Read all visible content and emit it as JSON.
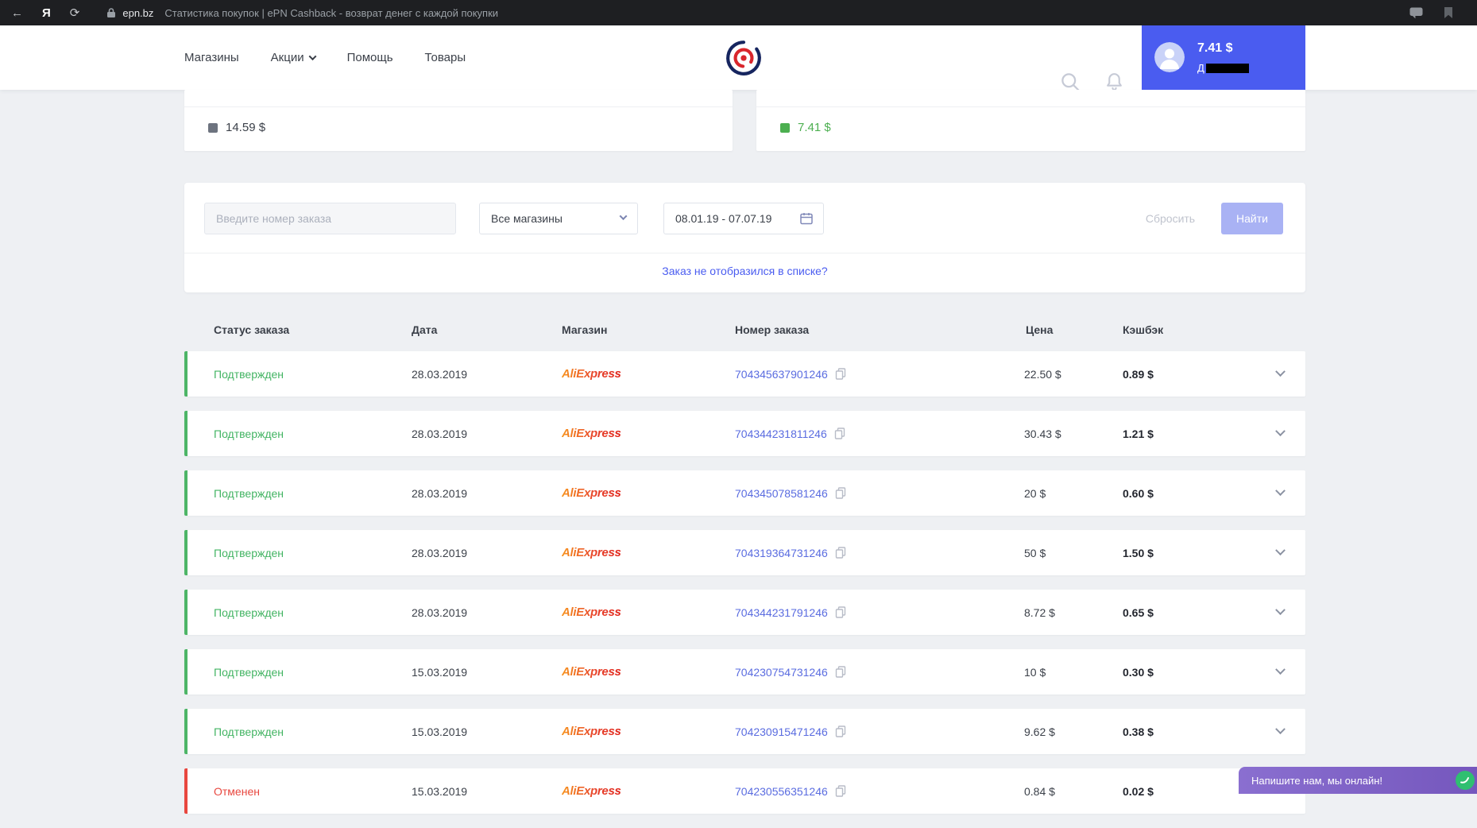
{
  "browser": {
    "back_icon": "←",
    "logo_letter": "Я",
    "refresh_icon": "⟳",
    "domain": "epn.bz",
    "page_title": "Статистика покупок | ePN Cashback - возврат денег с каждой покупки"
  },
  "header": {
    "nav": [
      {
        "label": "Магазины"
      },
      {
        "label": "Акции"
      },
      {
        "label": "Помощь"
      },
      {
        "label": "Товары"
      }
    ],
    "balance": "7.41 $",
    "user_name_prefix": "Д"
  },
  "stats": {
    "total": {
      "value": "14.59 $",
      "color": "#6d737f"
    },
    "available": {
      "value": "7.41 $",
      "color": "#4caf50"
    }
  },
  "filter": {
    "order_placeholder": "Введите номер заказа",
    "shop_select_value": "Все магазины",
    "date_range": "08.01.19 - 07.07.19",
    "reset_label": "Сбросить",
    "find_label": "Найти",
    "missing_order_link": "Заказ не отобразился в списке?"
  },
  "table": {
    "headers": [
      "Статус заказа",
      "Дата",
      "Магазин",
      "Номер заказа",
      "Цена",
      "Кэшбэк"
    ],
    "rows": [
      {
        "status": "Подтвержден",
        "status_type": "confirmed",
        "date": "28.03.2019",
        "shop": "AliExpress",
        "order": "704345637901246",
        "price": "22.50 $",
        "cashback": "0.89 $"
      },
      {
        "status": "Подтвержден",
        "status_type": "confirmed",
        "date": "28.03.2019",
        "shop": "AliExpress",
        "order": "704344231811246",
        "price": "30.43 $",
        "cashback": "1.21 $"
      },
      {
        "status": "Подтвержден",
        "status_type": "confirmed",
        "date": "28.03.2019",
        "shop": "AliExpress",
        "order": "704345078581246",
        "price": "20 $",
        "cashback": "0.60 $"
      },
      {
        "status": "Подтвержден",
        "status_type": "confirmed",
        "date": "28.03.2019",
        "shop": "AliExpress",
        "order": "704319364731246",
        "price": "50 $",
        "cashback": "1.50 $"
      },
      {
        "status": "Подтвержден",
        "status_type": "confirmed",
        "date": "28.03.2019",
        "shop": "AliExpress",
        "order": "704344231791246",
        "price": "8.72 $",
        "cashback": "0.65 $"
      },
      {
        "status": "Подтвержден",
        "status_type": "confirmed",
        "date": "15.03.2019",
        "shop": "AliExpress",
        "order": "704230754731246",
        "price": "10 $",
        "cashback": "0.30 $"
      },
      {
        "status": "Подтвержден",
        "status_type": "confirmed",
        "date": "15.03.2019",
        "shop": "AliExpress",
        "order": "704230915471246",
        "price": "9.62 $",
        "cashback": "0.38 $"
      },
      {
        "status": "Отменен",
        "status_type": "cancelled",
        "date": "15.03.2019",
        "shop": "AliExpress",
        "order": "704230556351246",
        "price": "0.84 $",
        "cashback": "0.02 $"
      }
    ]
  },
  "chat": {
    "label": "Напишите нам, мы онлайн!"
  },
  "colors": {
    "accent_blue": "#4a5cf0",
    "green": "#43b463",
    "red": "#e8473f",
    "find_button": "#a9b2f4"
  }
}
